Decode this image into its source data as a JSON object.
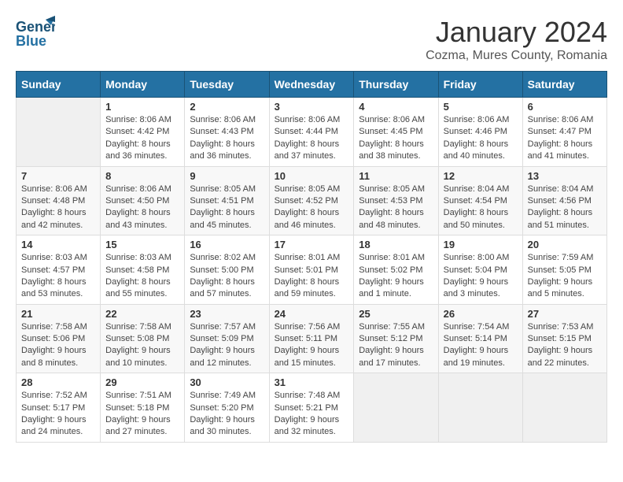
{
  "header": {
    "logo_line1": "General",
    "logo_line2": "Blue",
    "month": "January 2024",
    "location": "Cozma, Mures County, Romania"
  },
  "weekdays": [
    "Sunday",
    "Monday",
    "Tuesday",
    "Wednesday",
    "Thursday",
    "Friday",
    "Saturday"
  ],
  "weeks": [
    [
      null,
      {
        "day": 1,
        "sunrise": "8:06 AM",
        "sunset": "4:42 PM",
        "daylight": "8 hours and 36 minutes."
      },
      {
        "day": 2,
        "sunrise": "8:06 AM",
        "sunset": "4:43 PM",
        "daylight": "8 hours and 36 minutes."
      },
      {
        "day": 3,
        "sunrise": "8:06 AM",
        "sunset": "4:44 PM",
        "daylight": "8 hours and 37 minutes."
      },
      {
        "day": 4,
        "sunrise": "8:06 AM",
        "sunset": "4:45 PM",
        "daylight": "8 hours and 38 minutes."
      },
      {
        "day": 5,
        "sunrise": "8:06 AM",
        "sunset": "4:46 PM",
        "daylight": "8 hours and 40 minutes."
      },
      {
        "day": 6,
        "sunrise": "8:06 AM",
        "sunset": "4:47 PM",
        "daylight": "8 hours and 41 minutes."
      }
    ],
    [
      {
        "day": 7,
        "sunrise": "8:06 AM",
        "sunset": "4:48 PM",
        "daylight": "8 hours and 42 minutes."
      },
      {
        "day": 8,
        "sunrise": "8:06 AM",
        "sunset": "4:50 PM",
        "daylight": "8 hours and 43 minutes."
      },
      {
        "day": 9,
        "sunrise": "8:05 AM",
        "sunset": "4:51 PM",
        "daylight": "8 hours and 45 minutes."
      },
      {
        "day": 10,
        "sunrise": "8:05 AM",
        "sunset": "4:52 PM",
        "daylight": "8 hours and 46 minutes."
      },
      {
        "day": 11,
        "sunrise": "8:05 AM",
        "sunset": "4:53 PM",
        "daylight": "8 hours and 48 minutes."
      },
      {
        "day": 12,
        "sunrise": "8:04 AM",
        "sunset": "4:54 PM",
        "daylight": "8 hours and 50 minutes."
      },
      {
        "day": 13,
        "sunrise": "8:04 AM",
        "sunset": "4:56 PM",
        "daylight": "8 hours and 51 minutes."
      }
    ],
    [
      {
        "day": 14,
        "sunrise": "8:03 AM",
        "sunset": "4:57 PM",
        "daylight": "8 hours and 53 minutes."
      },
      {
        "day": 15,
        "sunrise": "8:03 AM",
        "sunset": "4:58 PM",
        "daylight": "8 hours and 55 minutes."
      },
      {
        "day": 16,
        "sunrise": "8:02 AM",
        "sunset": "5:00 PM",
        "daylight": "8 hours and 57 minutes."
      },
      {
        "day": 17,
        "sunrise": "8:01 AM",
        "sunset": "5:01 PM",
        "daylight": "8 hours and 59 minutes."
      },
      {
        "day": 18,
        "sunrise": "8:01 AM",
        "sunset": "5:02 PM",
        "daylight": "9 hours and 1 minute."
      },
      {
        "day": 19,
        "sunrise": "8:00 AM",
        "sunset": "5:04 PM",
        "daylight": "9 hours and 3 minutes."
      },
      {
        "day": 20,
        "sunrise": "7:59 AM",
        "sunset": "5:05 PM",
        "daylight": "9 hours and 5 minutes."
      }
    ],
    [
      {
        "day": 21,
        "sunrise": "7:58 AM",
        "sunset": "5:06 PM",
        "daylight": "9 hours and 8 minutes."
      },
      {
        "day": 22,
        "sunrise": "7:58 AM",
        "sunset": "5:08 PM",
        "daylight": "9 hours and 10 minutes."
      },
      {
        "day": 23,
        "sunrise": "7:57 AM",
        "sunset": "5:09 PM",
        "daylight": "9 hours and 12 minutes."
      },
      {
        "day": 24,
        "sunrise": "7:56 AM",
        "sunset": "5:11 PM",
        "daylight": "9 hours and 15 minutes."
      },
      {
        "day": 25,
        "sunrise": "7:55 AM",
        "sunset": "5:12 PM",
        "daylight": "9 hours and 17 minutes."
      },
      {
        "day": 26,
        "sunrise": "7:54 AM",
        "sunset": "5:14 PM",
        "daylight": "9 hours and 19 minutes."
      },
      {
        "day": 27,
        "sunrise": "7:53 AM",
        "sunset": "5:15 PM",
        "daylight": "9 hours and 22 minutes."
      }
    ],
    [
      {
        "day": 28,
        "sunrise": "7:52 AM",
        "sunset": "5:17 PM",
        "daylight": "9 hours and 24 minutes."
      },
      {
        "day": 29,
        "sunrise": "7:51 AM",
        "sunset": "5:18 PM",
        "daylight": "9 hours and 27 minutes."
      },
      {
        "day": 30,
        "sunrise": "7:49 AM",
        "sunset": "5:20 PM",
        "daylight": "9 hours and 30 minutes."
      },
      {
        "day": 31,
        "sunrise": "7:48 AM",
        "sunset": "5:21 PM",
        "daylight": "9 hours and 32 minutes."
      },
      null,
      null,
      null
    ]
  ]
}
